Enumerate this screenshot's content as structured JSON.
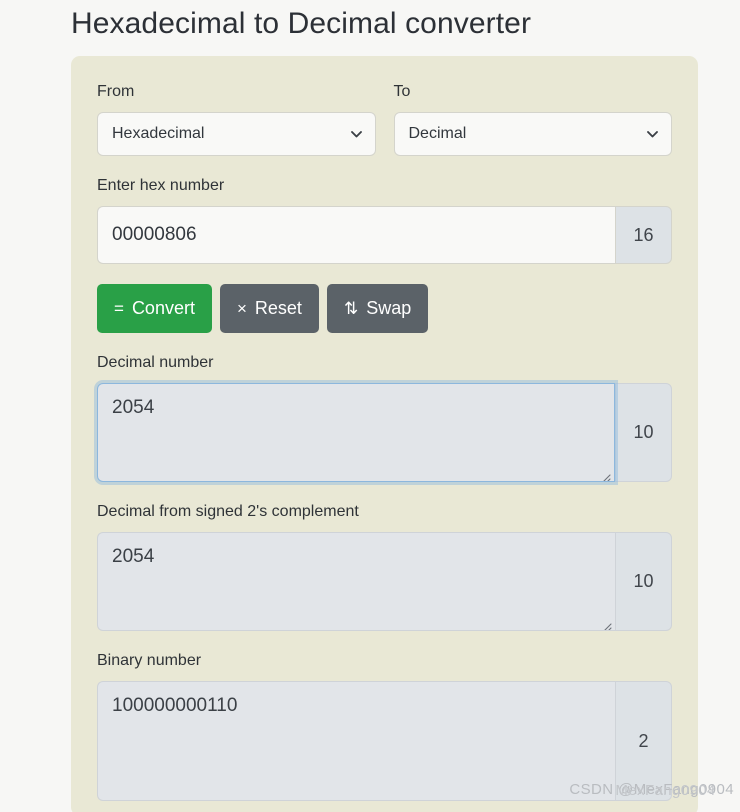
{
  "page": {
    "title": "Hexadecimal to Decimal converter",
    "background_color": "#f7f7f5",
    "card_color": "#e9e8d5"
  },
  "converter": {
    "from": {
      "label": "From",
      "value": "Hexadecimal",
      "icon": "chevron-down-icon"
    },
    "to": {
      "label": "To",
      "value": "Decimal",
      "icon": "chevron-down-icon"
    },
    "input": {
      "label": "Enter hex number",
      "value": "00000806",
      "base": "16"
    },
    "buttons": [
      {
        "name": "convert",
        "icon": "=",
        "label": "Convert",
        "color": "#29a047"
      },
      {
        "name": "reset",
        "icon": "×",
        "label": "Reset",
        "color": "#5b6268"
      },
      {
        "name": "swap",
        "icon": "⇅",
        "label": "Swap",
        "color": "#5b6268"
      }
    ],
    "results": [
      {
        "name": "decimal-number",
        "label": "Decimal number",
        "value": "2054",
        "base": "10",
        "focused": true
      },
      {
        "name": "decimal-signed-twos-complement",
        "label": "Decimal from signed 2's complement",
        "value": "2054",
        "base": "10",
        "focused": false
      },
      {
        "name": "binary-number",
        "label": "Binary number",
        "value": "100000000110",
        "base": "2",
        "focused": false
      }
    ]
  },
  "watermark": {
    "text": "CSDN @MexFang0904",
    "overlay": "MexFang0904"
  }
}
